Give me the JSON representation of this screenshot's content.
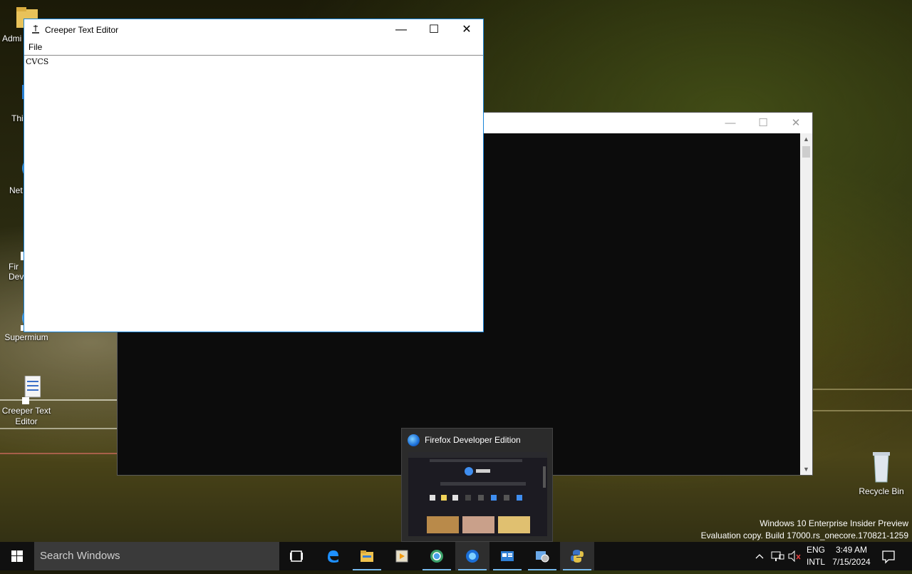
{
  "desktop": {
    "icons": [
      {
        "label": "Admi",
        "icon": "folder-icon"
      },
      {
        "label": "Thi",
        "icon": "this-pc-icon"
      },
      {
        "label": "Net",
        "icon": "network-icon"
      },
      {
        "label": "Fir\nDeve",
        "icon": "firefox-shortcut-icon"
      },
      {
        "label": "Supermium",
        "icon": "supermium-icon"
      },
      {
        "label": "Creeper Text\nEditor",
        "icon": "text-editor-shortcut-icon"
      }
    ],
    "recycle_bin_label": "Recycle Bin"
  },
  "editor": {
    "title": "Creeper Text Editor",
    "menu_file": "File",
    "content": "CVCS"
  },
  "console": {
    "title": ""
  },
  "preview": {
    "title": "Firefox Developer Edition"
  },
  "watermark": {
    "line1": "Windows 10 Enterprise Insider Preview",
    "line2": "Evaluation copy. Build 17000.rs_onecore.170821-1259"
  },
  "taskbar": {
    "search_placeholder": "Search Windows",
    "items": [
      {
        "name": "task-view-icon"
      },
      {
        "name": "edge-icon"
      },
      {
        "name": "file-explorer-icon"
      },
      {
        "name": "media-player-icon"
      },
      {
        "name": "supermium-icon"
      },
      {
        "name": "firefox-dev-icon"
      },
      {
        "name": "app-window-icon"
      },
      {
        "name": "system-settings-icon"
      },
      {
        "name": "python-icon"
      }
    ],
    "language": "ENG",
    "layout": "INTL",
    "time": "3:49 AM",
    "date": "7/15/2024"
  },
  "colors": {
    "accent": "#1883d7",
    "taskbar": "#101010",
    "console_bg": "#0c0c0c"
  }
}
